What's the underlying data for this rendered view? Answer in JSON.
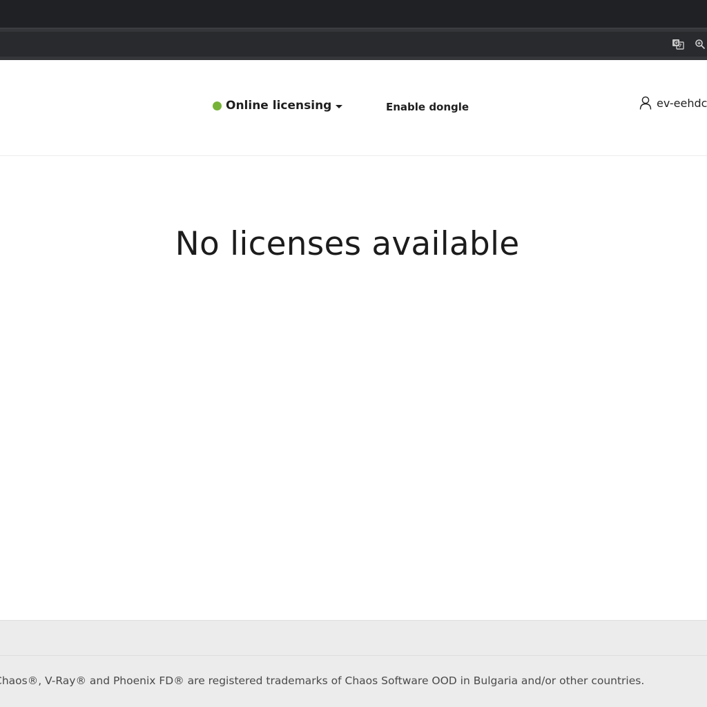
{
  "header": {
    "licensing_status": "Online licensing",
    "status_color": "#77b338",
    "enable_dongle_label": "Enable dongle",
    "user_name": "ev-eehdc"
  },
  "main": {
    "empty_message": "No licenses available"
  },
  "footer": {
    "trademark_text": "Chaos®, V-Ray® and Phoenix FD® are registered trademarks of Chaos Software OOD in Bulgaria and/or other countries."
  },
  "browser": {
    "icons": [
      "translate-icon",
      "zoom-icon"
    ]
  }
}
